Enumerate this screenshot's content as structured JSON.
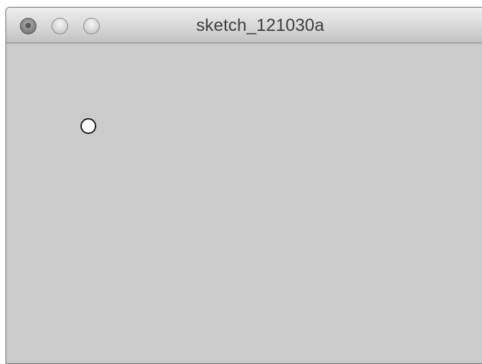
{
  "window": {
    "title": "sketch_121030a"
  },
  "controls": {
    "close_icon": "traffic-light-close",
    "minimize_icon": "traffic-light-minimize",
    "zoom_icon": "traffic-light-zoom"
  },
  "canvas": {
    "background": "#cbcbcc",
    "shape": "circle",
    "shape_fill": "#ffffff",
    "shape_stroke": "#1a1a1a"
  }
}
